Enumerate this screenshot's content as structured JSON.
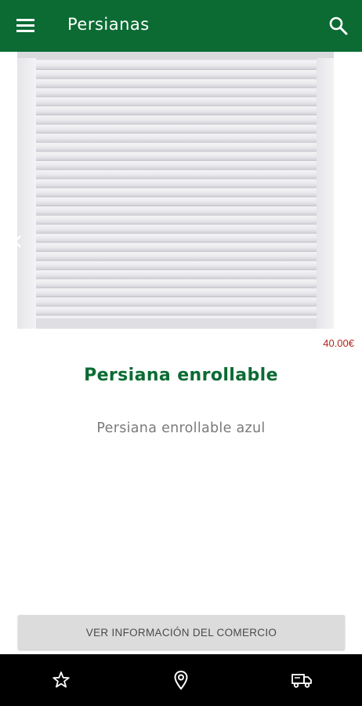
{
  "appbar": {
    "title": "Persianas",
    "menu_icon": "hamburger-menu-icon",
    "search_icon": "search-icon",
    "background": "#0b6b33"
  },
  "gallery": {
    "image": "roller-shutter-photo",
    "prev_icon": "chevron-left-icon"
  },
  "product": {
    "price": "40.00€",
    "name": "Persiana enrollable",
    "description": "Persiana enrollable azul",
    "price_color": "#b3261e",
    "name_color": "#0b6b33"
  },
  "actions": {
    "info_button_label": "VER INFORMACIÓN DEL COMERCIO"
  },
  "bottom_nav": {
    "items": [
      {
        "icon": "star-outline-icon"
      },
      {
        "icon": "map-pin-icon"
      },
      {
        "icon": "delivery-truck-icon"
      }
    ],
    "background": "#000000"
  }
}
